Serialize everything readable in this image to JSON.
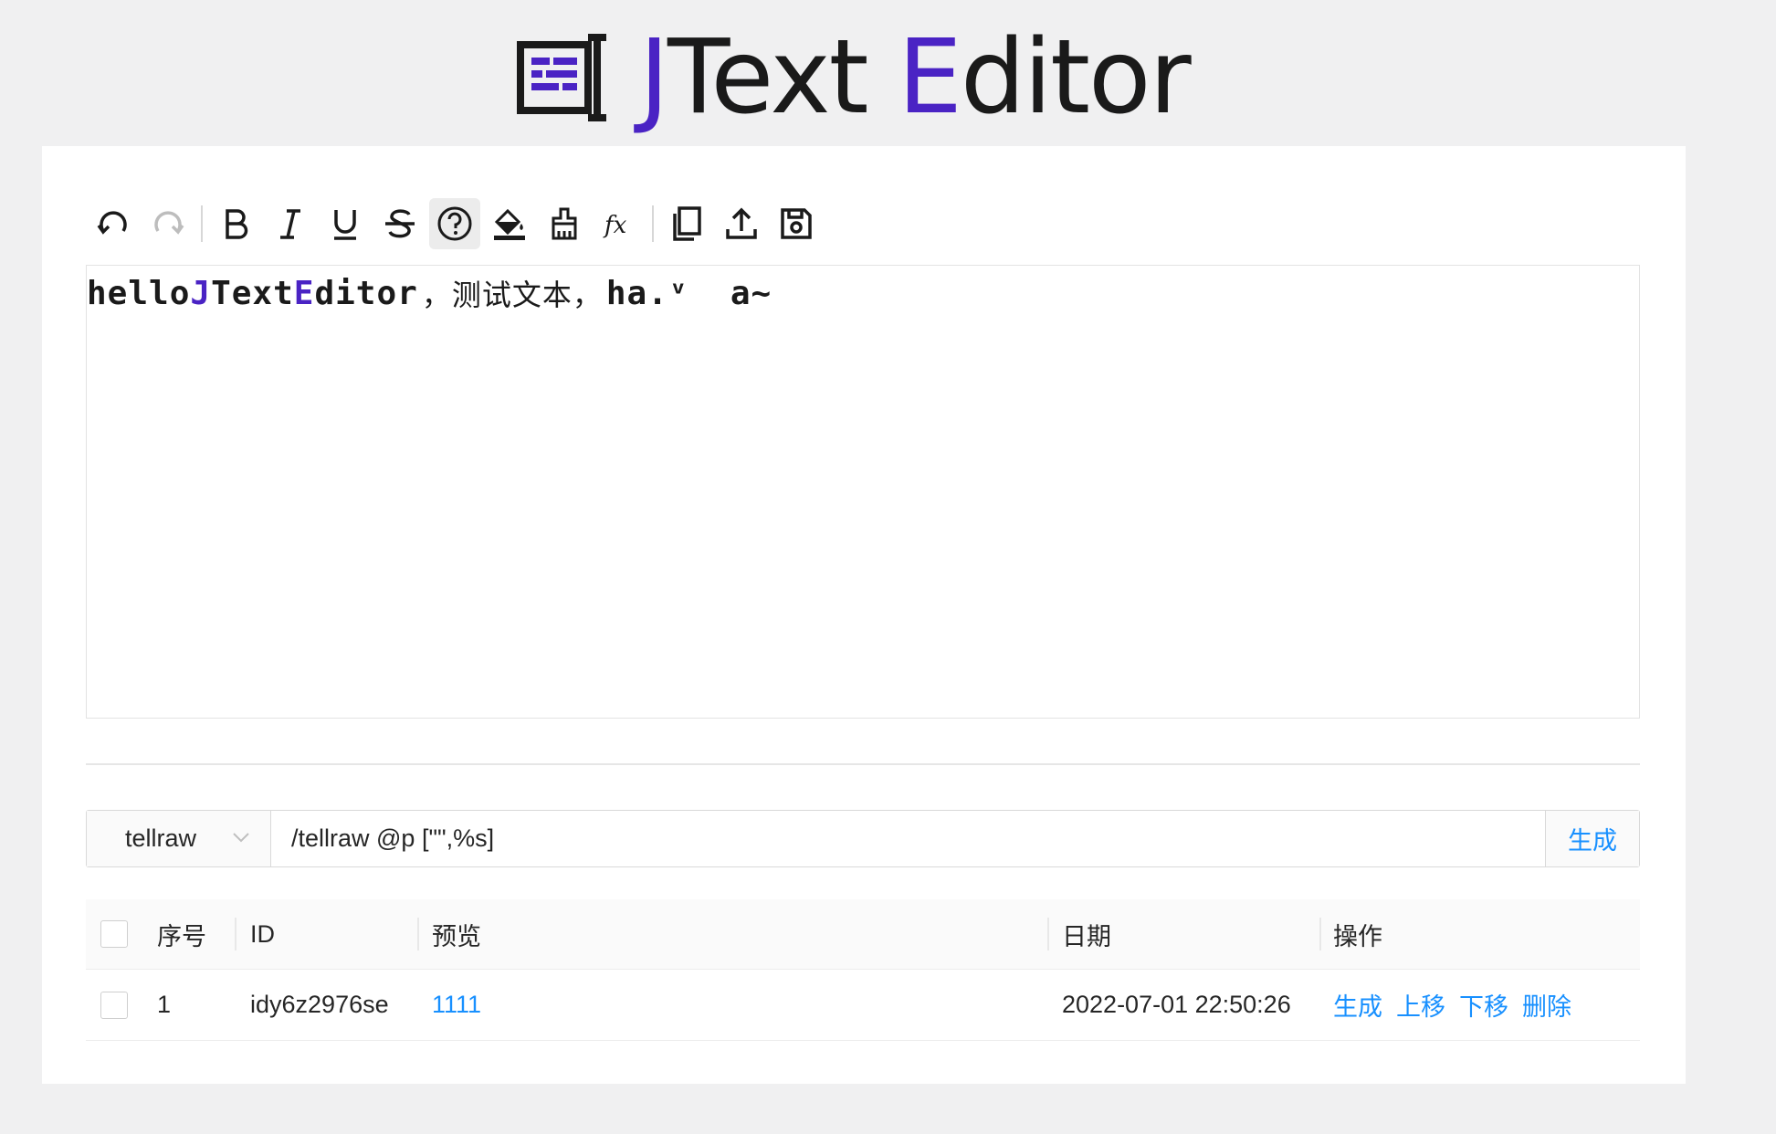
{
  "app": {
    "logo_icon": "text-editor-icon",
    "title_parts": [
      {
        "text": "J",
        "accent": true
      },
      {
        "text": "Text ",
        "accent": false
      },
      {
        "text": "E",
        "accent": true
      },
      {
        "text": "ditor",
        "accent": false
      }
    ],
    "accent_color": "#4a23c4",
    "link_color": "#1890ff"
  },
  "toolbar": {
    "buttons": [
      {
        "icon": "undo-icon",
        "active": false
      },
      {
        "icon": "redo-icon",
        "active": false,
        "disabled": true
      },
      {
        "icon": "bold-icon",
        "active": false
      },
      {
        "icon": "italic-icon",
        "active": false
      },
      {
        "icon": "underline-icon",
        "active": false
      },
      {
        "icon": "strikethrough-icon",
        "active": false
      },
      {
        "icon": "obfuscated-help-icon",
        "active": true
      },
      {
        "icon": "fill-color-icon",
        "active": false
      },
      {
        "icon": "clear-format-icon",
        "active": false
      },
      {
        "icon": "function-icon",
        "active": false
      },
      {
        "icon": "copy-icon",
        "active": false
      },
      {
        "icon": "upload-icon",
        "active": false
      },
      {
        "icon": "save-icon",
        "active": false
      }
    ]
  },
  "editor": {
    "segments": [
      {
        "text": "hello",
        "style": "plain"
      },
      {
        "text": "J",
        "style": "accent"
      },
      {
        "text": "Text ",
        "style": "plain"
      },
      {
        "text": "E",
        "style": "accent"
      },
      {
        "text": "ditor",
        "style": "plain"
      },
      {
        "text": "，测试文本，",
        "style": "cjk"
      },
      {
        "text": "ha.ᵛ  a~",
        "style": "plain"
      }
    ]
  },
  "command": {
    "select_value": "tellraw",
    "input_value": "/tellraw @p [\"\",%s]",
    "generate_label": "生成"
  },
  "table": {
    "headers": {
      "no": "序号",
      "id": "ID",
      "preview": "预览",
      "date": "日期",
      "ops": "操作"
    },
    "rows": [
      {
        "no": "1",
        "id": "idy6z2976se",
        "preview": "1111",
        "date": "2022-07-01 22:50:26",
        "ops": [
          "生成",
          "上移",
          "下移",
          "删除"
        ]
      }
    ]
  }
}
